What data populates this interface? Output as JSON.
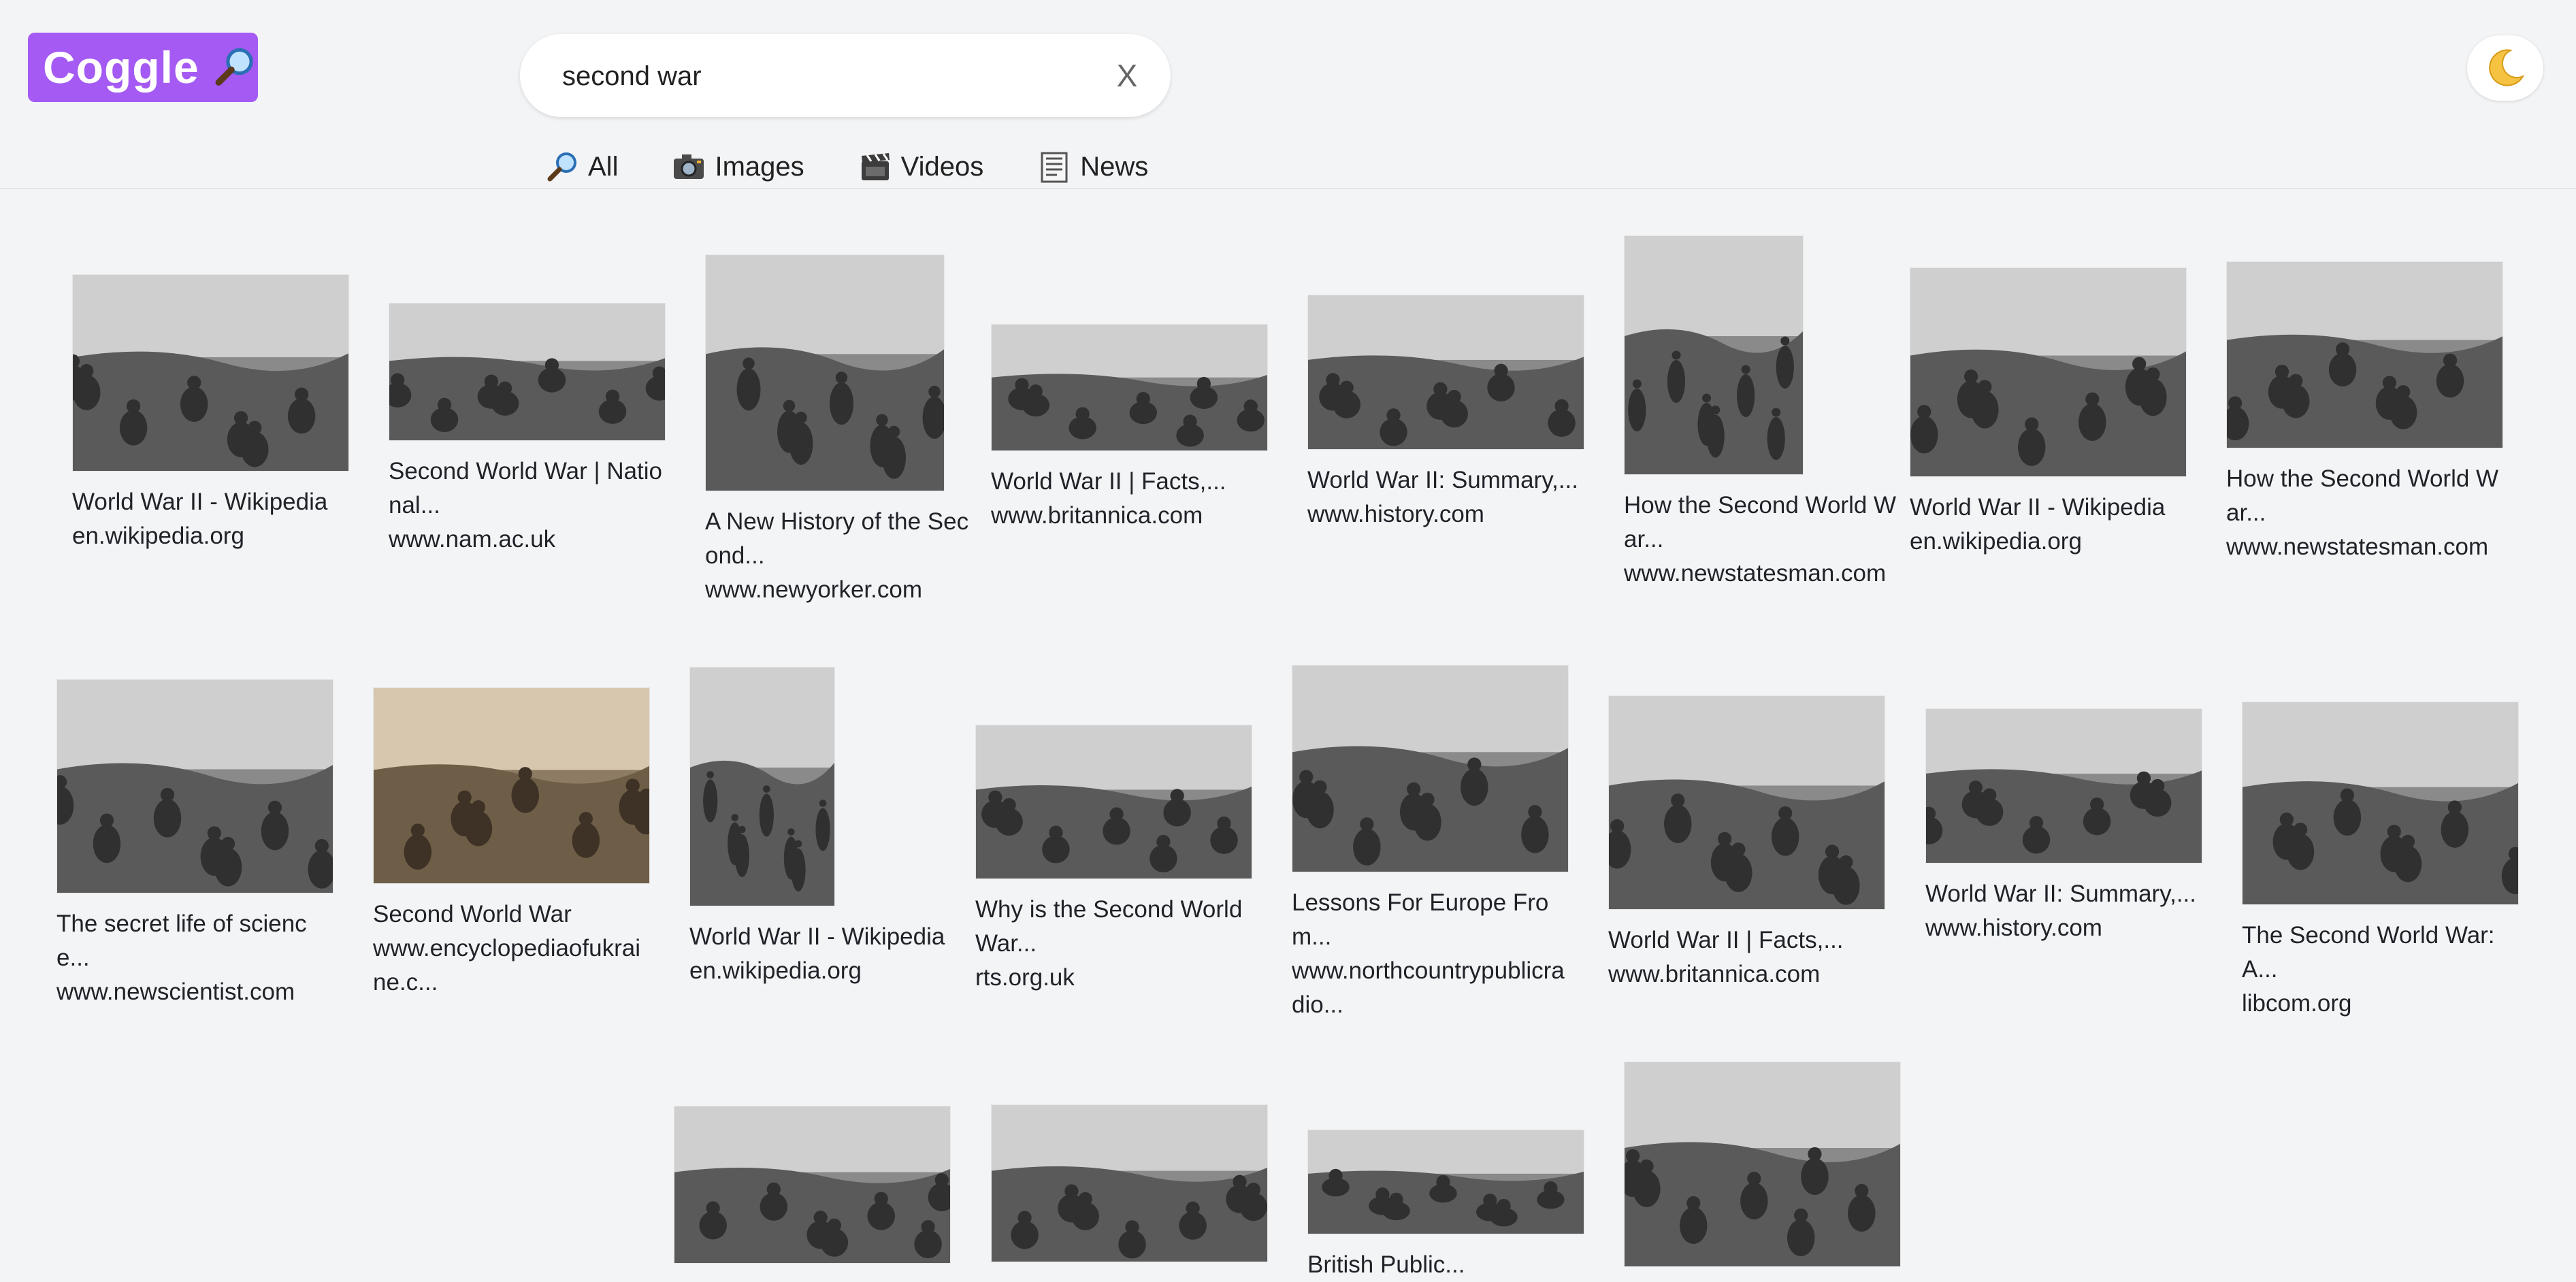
{
  "app": {
    "logo_text": "Coggle"
  },
  "search": {
    "query": "second war",
    "clear_label": "X"
  },
  "tabs": [
    {
      "label": "All",
      "icon": "magnifier-icon"
    },
    {
      "label": "Images",
      "icon": "camera-icon"
    },
    {
      "label": "Videos",
      "icon": "film-clapper-icon"
    },
    {
      "label": "News",
      "icon": "newspaper-icon"
    }
  ],
  "theme_toggle": {
    "icon": "crescent-moon-icon"
  },
  "results": [
    {
      "title": "World War II - Wikipedia",
      "source": "en.wikipedia.org"
    },
    {
      "title": "Second World War | National...",
      "source": "www.nam.ac.uk"
    },
    {
      "title": "A New History of the Second...",
      "source": "www.newyorker.com"
    },
    {
      "title": "World War II | Facts,...",
      "source": "www.britannica.com"
    },
    {
      "title": "World War II: Summary,...",
      "source": "www.history.com"
    },
    {
      "title": "How the Second World War...",
      "source": "www.newstatesman.com"
    },
    {
      "title": "World War II - Wikipedia",
      "source": "en.wikipedia.org"
    },
    {
      "title": "How the Second World War...",
      "source": "www.newstatesman.com"
    },
    {
      "title": "The secret life of science...",
      "source": "www.newscientist.com"
    },
    {
      "title": "Second World War",
      "source": "www.encyclopediaofukraine.c..."
    },
    {
      "title": "World War II - Wikipedia",
      "source": "en.wikipedia.org"
    },
    {
      "title": "Why is the Second World War...",
      "source": "rts.org.uk"
    },
    {
      "title": "Lessons For Europe From...",
      "source": "www.northcountrypublicradio..."
    },
    {
      "title": "World War II | Facts,...",
      "source": "www.britannica.com"
    },
    {
      "title": "World War II: Summary,...",
      "source": "www.history.com"
    },
    {
      "title": "The Second World War: A...",
      "source": "libcom.org"
    },
    {
      "title": "",
      "source": ""
    },
    {
      "title": "",
      "source": ""
    },
    {
      "title": "British Public...",
      "source": ""
    },
    {
      "title": "",
      "source": ""
    }
  ]
}
